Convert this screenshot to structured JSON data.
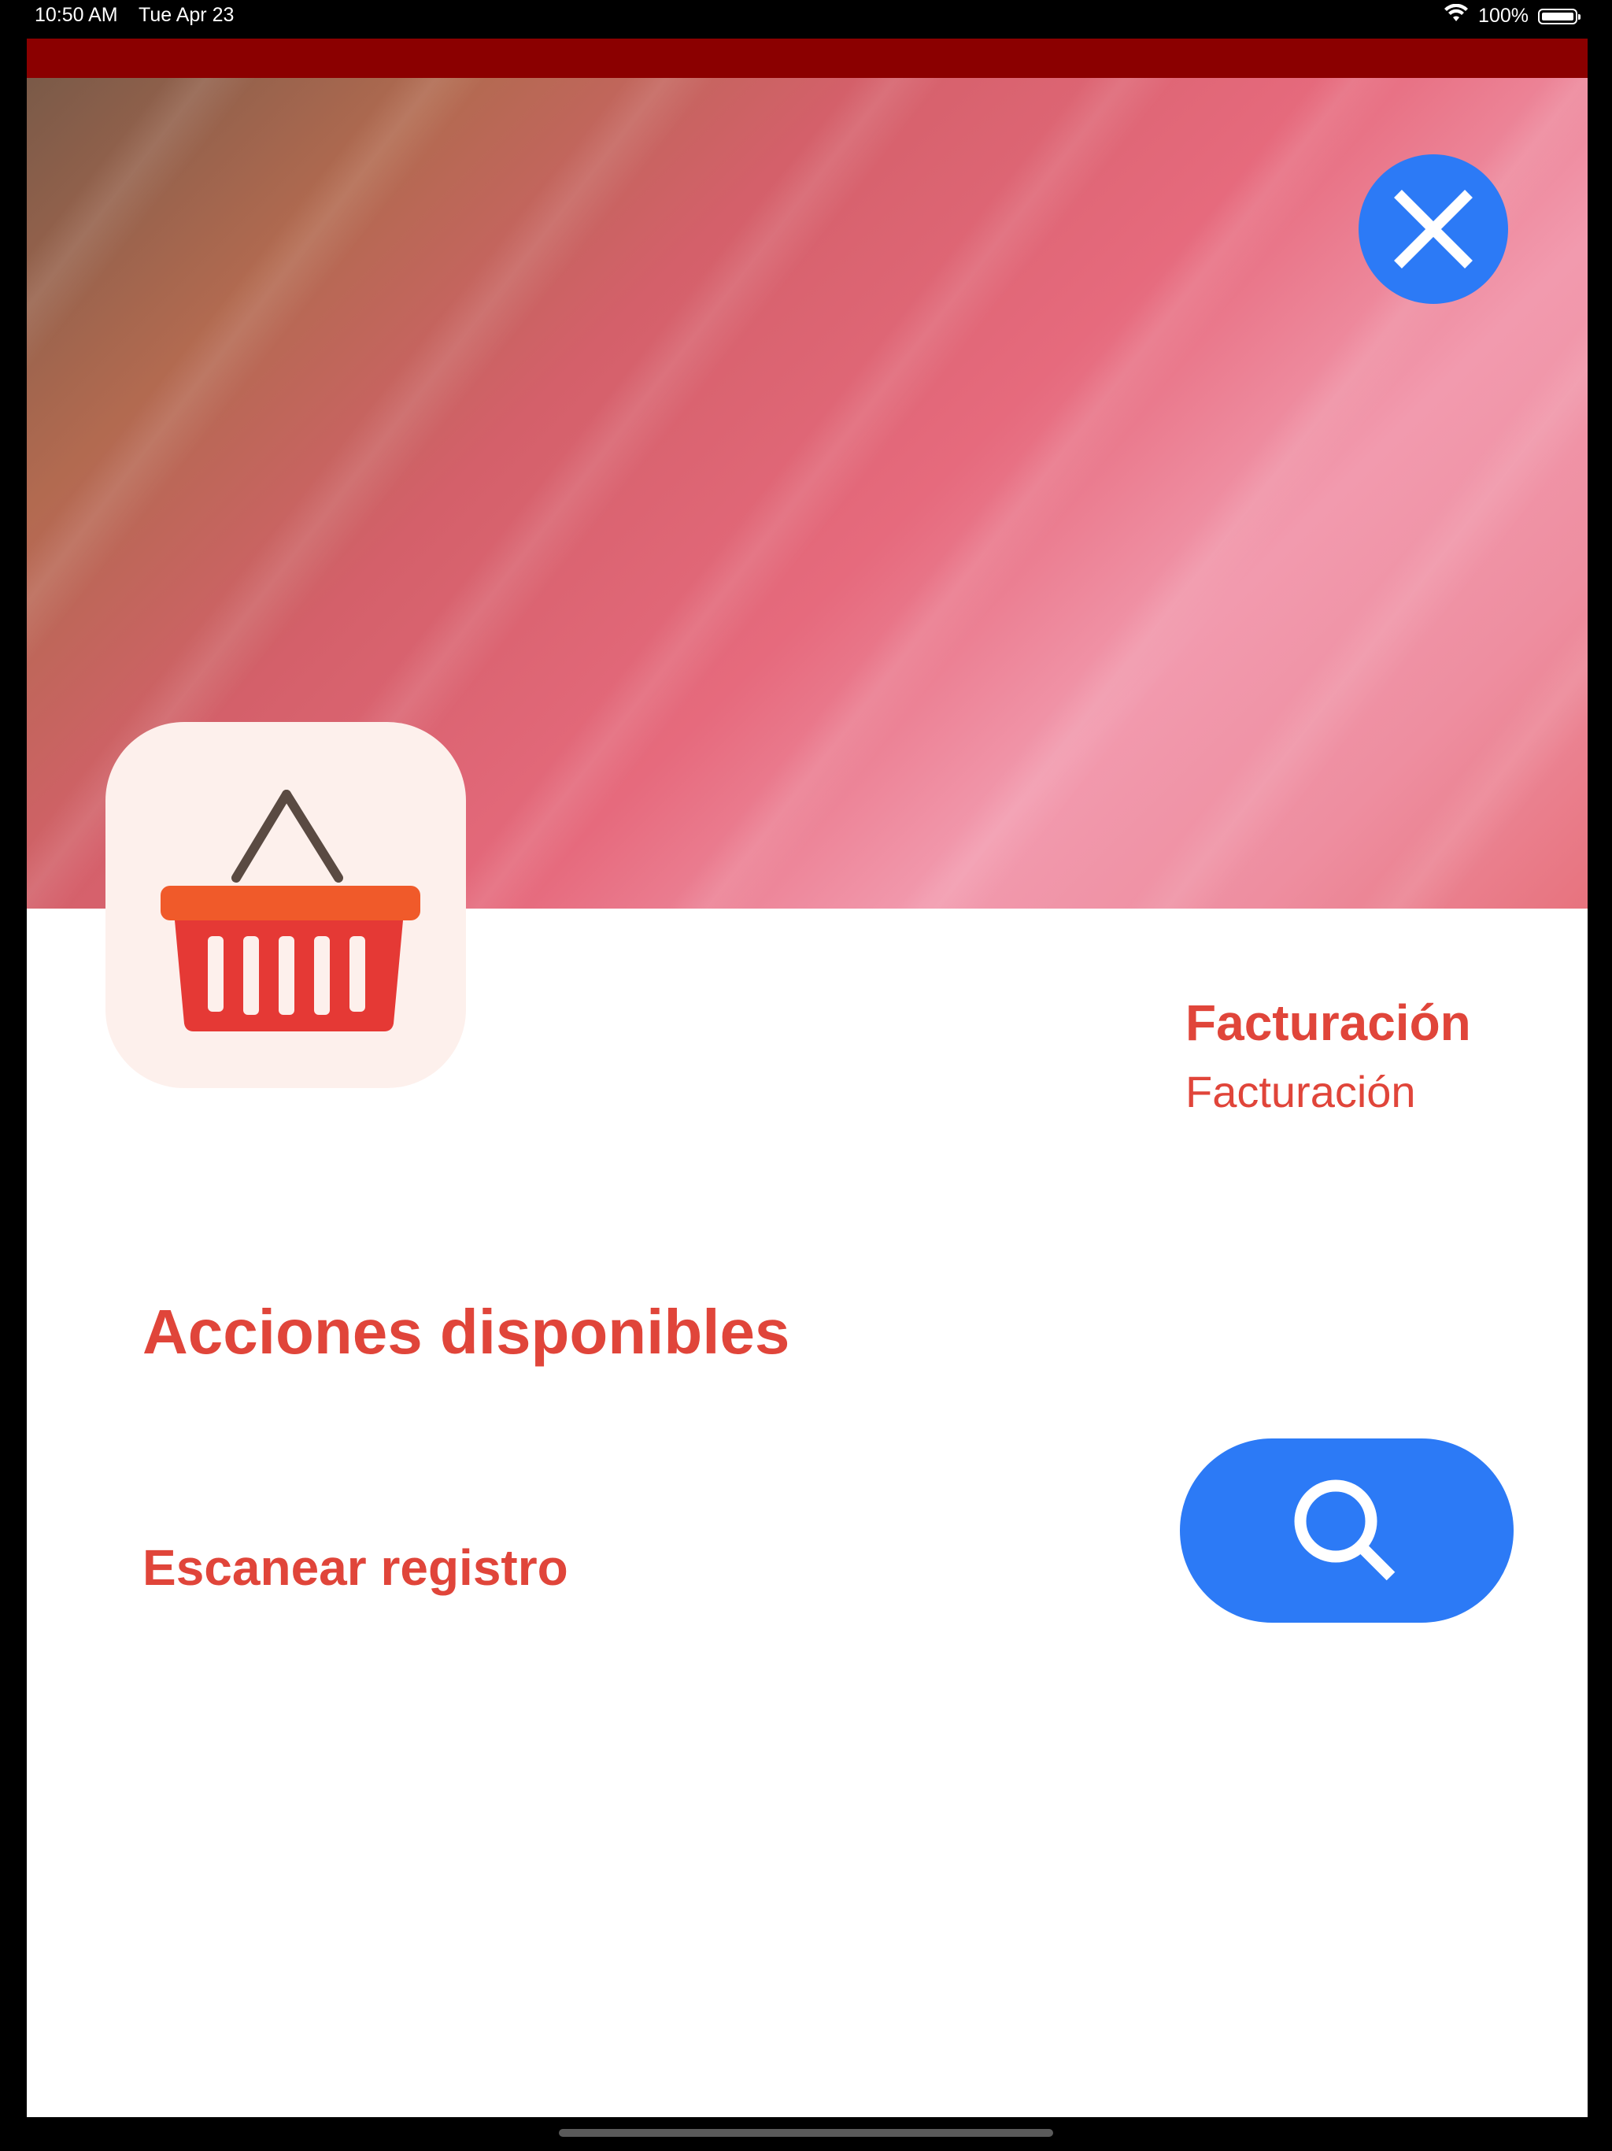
{
  "status_bar": {
    "time": "10:50 AM",
    "date": "Tue Apr 23",
    "battery": "100%",
    "battery_level": 1.0,
    "icons": [
      "wifi-icon",
      "battery-icon"
    ]
  },
  "header": {
    "close_icon": "close-icon"
  },
  "app": {
    "icon": "shopping-basket-icon",
    "title": "Facturación",
    "subtitle": "Facturación"
  },
  "actions": {
    "section_title": "Acciones disponibles",
    "items": [
      {
        "label": "Escanear registro",
        "button_icon": "search-icon"
      }
    ]
  },
  "colors": {
    "accent_red": "#e0453a",
    "top_bar": "#8b0000",
    "button_blue": "#2c7af6",
    "icon_bg": "#fdf0ec"
  }
}
